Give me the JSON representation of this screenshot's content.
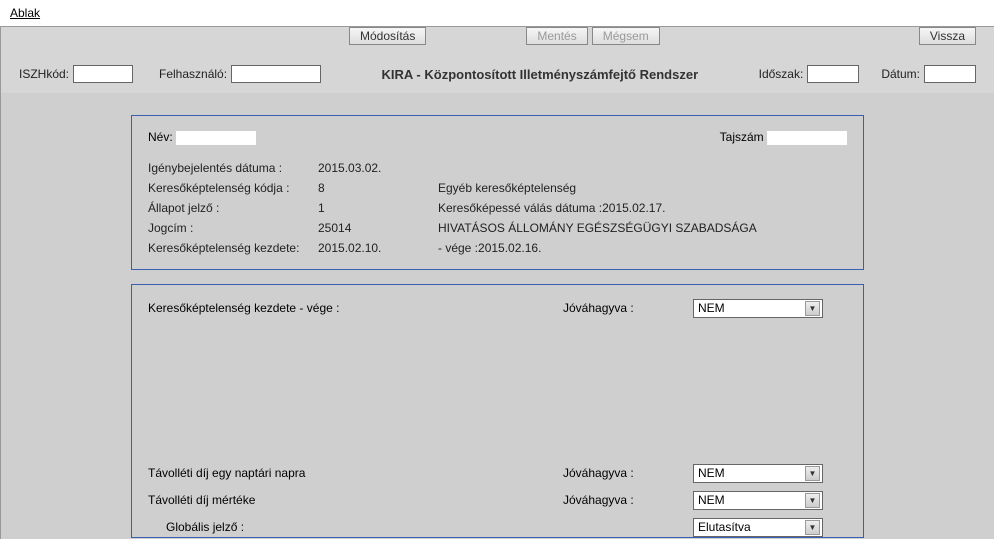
{
  "menu": {
    "ablak": "Ablak"
  },
  "buttons": {
    "modositas": "Módosítás",
    "mentes": "Mentés",
    "megsem": "Mégsem",
    "vissza": "Vissza"
  },
  "header": {
    "iszh_label": "ISZHkód:",
    "iszh_value": "",
    "felh_label": "Felhasználó:",
    "felh_value": "",
    "title": "KIRA - Központosított Illetményszámfejtő Rendszer",
    "idoszak_label": "Időszak:",
    "idoszak_value": "",
    "datum_label": "Dátum:",
    "datum_value": ""
  },
  "panel1": {
    "nev_label": "Név:",
    "nev_value": "",
    "tajszam_label": "Tajszám",
    "tajszam_value": "",
    "igeny_label": "Igénybejelentés dátuma :",
    "igeny_value": "2015.03.02.",
    "kkod_label": "Keresőképtelenség kódja :",
    "kkod_value": "8",
    "kkod_desc": "Egyéb keresőképtelenség",
    "allapot_label": "Állapot jelző :",
    "allapot_value": "1",
    "kereso_label": "Keresőképessé válás dátuma :",
    "kereso_value": "2015.02.17.",
    "jogcim_label": "Jogcím :",
    "jogcim_value": "25014",
    "jogcim_desc": "HIVATÁSOS ÁLLOMÁNY EGÉSZSÉGÜGYI SZABADSÁGA",
    "kkezd_label": "Keresőképtelenség kezdete:",
    "kkezd_value": "2015.02.10.",
    "kvege_label": "- vége :",
    "kvege_value": "2015.02.16."
  },
  "panel2": {
    "row1_label": "Keresőképtelenség kezdete - vége :",
    "jovahagyva_label": "Jóváhagyva :",
    "row1_select": "NEM",
    "row2_label": "Távolléti díj egy naptári napra",
    "row2_select": "NEM",
    "row3_label": "Távolléti díj mértéke",
    "row3_select": "NEM",
    "row4_label": "Globális jelző :",
    "row4_select": "Elutasítva"
  }
}
